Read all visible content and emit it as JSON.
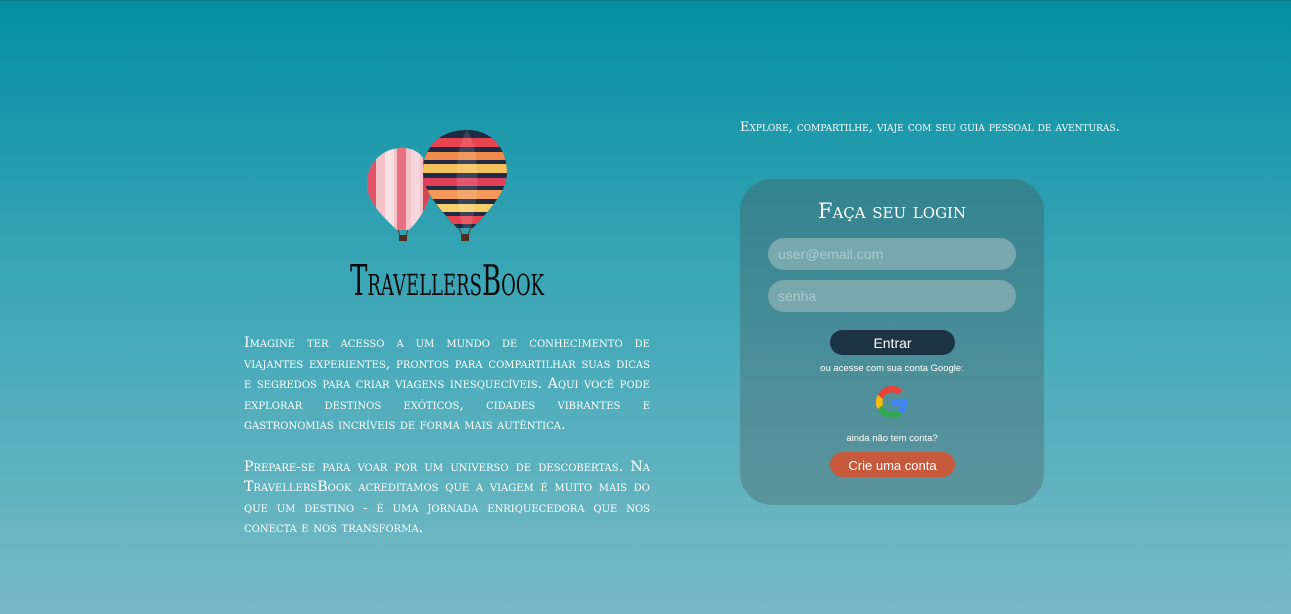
{
  "brand": {
    "logo_icon": "hot-air-balloons-icon",
    "name": "TravellersBook"
  },
  "intro": {
    "paragraph_1": "Imagine ter acesso a um mundo de conhecimento de viajantes experientes, prontos para compartilhar suas dicas e segredos para criar viagens inesquecíveis. Aqui você pode explorar destinos exóticos, cidades vibrantes e gastronomias incríveis de forma mais autêntica.",
    "paragraph_2": "Prepare-se para voar por um universo de descobertas. Na TravellersBook acreditamos que a viagem é muito mais do que um destino - é uma jornada enriquecedora que nos conecta e nos transforma."
  },
  "tagline": "Explore, compartilhe, viaje com seu guia pessoal de aventuras.",
  "login": {
    "title": "Faça seu login",
    "email_placeholder": "user@email.com",
    "email_value": "",
    "password_placeholder": "senha",
    "password_value": "",
    "submit_label": "Entrar",
    "google_prompt": "ou acesse com sua conta Google:",
    "google_icon": "google-g-icon",
    "no_account_text": "ainda não tem conta?",
    "create_account_label": "Crie uma conta"
  },
  "colors": {
    "background_top": "#048ea2",
    "background_bottom": "#78bac5",
    "card": "#438a95",
    "enter_button": "#1c3245",
    "create_button": "#c75a3c"
  }
}
